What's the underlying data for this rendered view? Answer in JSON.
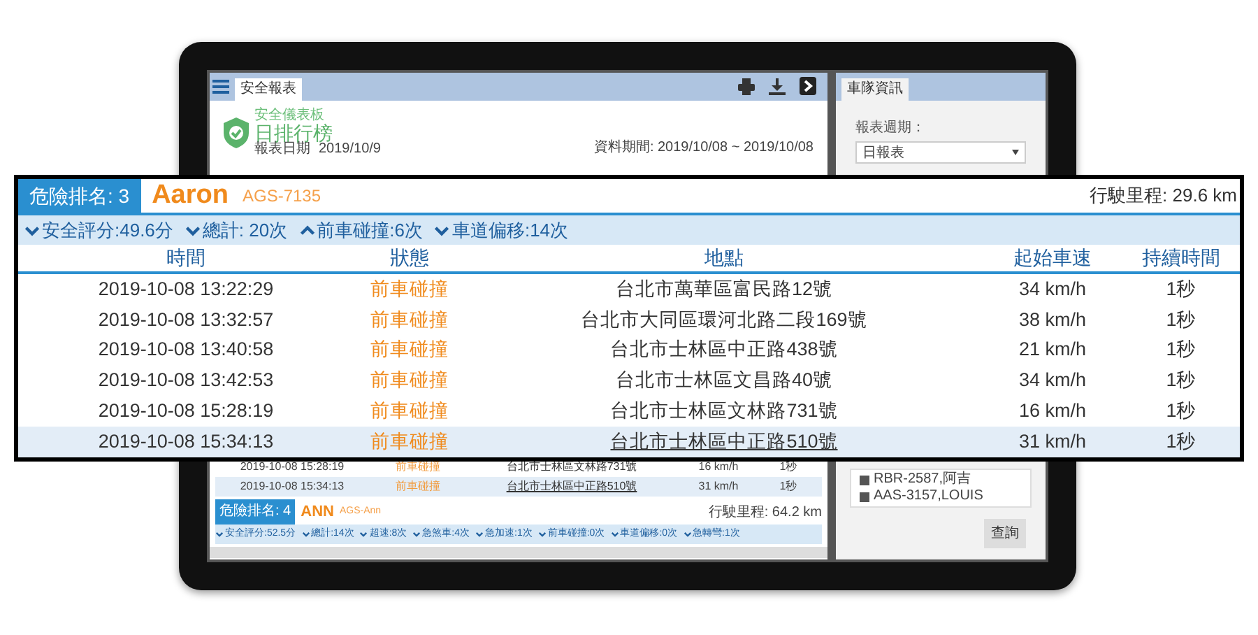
{
  "screen": {
    "toolbar": {
      "tab": "安全報表"
    },
    "header": {
      "subtitle": "安全儀表板",
      "title": "日排行榜",
      "date_label": "報表日期",
      "date": "2019/10/9",
      "period": "資料期間: 2019/10/08 ~ 2019/10/08"
    },
    "background_rows": [
      {
        "time": "2019-10-08 15:28:19",
        "status": "前車碰撞",
        "address": "台北市士林區文林路731號",
        "speed": "16 km/h",
        "duration": "1秒",
        "selected": false
      },
      {
        "time": "2019-10-08 15:34:13",
        "status": "前車碰撞",
        "address": "台北市士林區中正路510號",
        "speed": "31 km/h",
        "duration": "1秒",
        "selected": true
      }
    ],
    "next_driver": {
      "rank": "危險排名: 4",
      "name": "ANN",
      "plate": "AGS-Ann",
      "mileage": "行駛里程: 64.2 km",
      "stats": [
        {
          "text": "安全評分:52.5分",
          "kind": "down"
        },
        {
          "text": "總計:14次",
          "kind": "down"
        },
        {
          "text": "超速:8次",
          "kind": "down"
        },
        {
          "text": "急煞車:4次",
          "kind": "down"
        },
        {
          "text": "急加速:1次",
          "kind": "down"
        },
        {
          "text": "前車碰撞:0次",
          "kind": "down"
        },
        {
          "text": "車道偏移:0次",
          "kind": "down"
        },
        {
          "text": "急轉彎:1次",
          "kind": "down"
        }
      ]
    },
    "side_panel": {
      "tab": "車隊資訊",
      "period_label": "報表週期：",
      "period_value": "日報表",
      "vehicles": [
        {
          "text": "RBR-2587,阿吉",
          "checked": true
        },
        {
          "text": "AAS-3157,LOUIS",
          "checked": true
        }
      ],
      "query_button": "查詢"
    }
  },
  "callout": {
    "rank": "危險排名: 3",
    "name": "Aaron",
    "plate": "AGS-7135",
    "mileage": "行駛里程: 29.6 km",
    "stats": [
      {
        "text": "安全評分:49.6分",
        "kind": "down"
      },
      {
        "text": "總計: 20次",
        "kind": "down"
      },
      {
        "text": "前車碰撞:6次",
        "kind": "up"
      },
      {
        "text": "車道偏移:14次",
        "kind": "down"
      }
    ],
    "columns": [
      "時間",
      "狀態",
      "地點",
      "起始車速",
      "持續時間"
    ],
    "rows": [
      {
        "time": "2019-10-08 13:22:29",
        "status": "前車碰撞",
        "address": "台北市萬華區富民路12號",
        "speed": "34 km/h",
        "duration": "1秒",
        "selected": false
      },
      {
        "time": "2019-10-08 13:32:57",
        "status": "前車碰撞",
        "address": "台北市大同區環河北路二段169號",
        "speed": "38 km/h",
        "duration": "1秒",
        "selected": false
      },
      {
        "time": "2019-10-08 13:40:58",
        "status": "前車碰撞",
        "address": "台北市士林區中正路438號",
        "speed": "21 km/h",
        "duration": "1秒",
        "selected": false
      },
      {
        "time": "2019-10-08 13:42:53",
        "status": "前車碰撞",
        "address": "台北市士林區文昌路40號",
        "speed": "34 km/h",
        "duration": "1秒",
        "selected": false
      },
      {
        "time": "2019-10-08 15:28:19",
        "status": "前車碰撞",
        "address": "台北市士林區文林路731號",
        "speed": "16 km/h",
        "duration": "1秒",
        "selected": false
      },
      {
        "time": "2019-10-08 15:34:13",
        "status": "前車碰撞",
        "address": "台北市士林區中正路510號",
        "speed": "31 km/h",
        "duration": "1秒",
        "selected": true
      }
    ]
  }
}
